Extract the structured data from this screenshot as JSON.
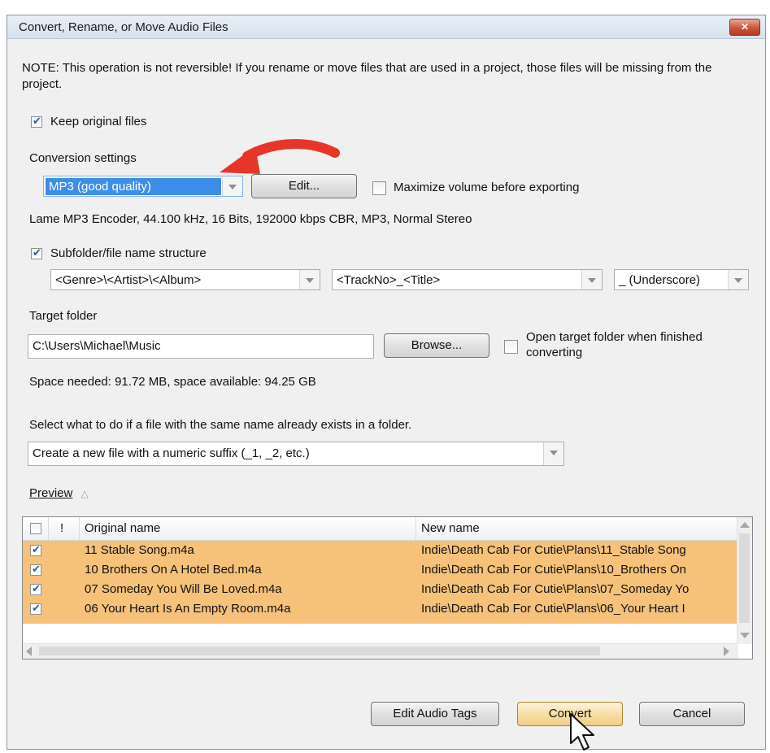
{
  "window": {
    "title": "Convert, Rename, or Move Audio Files",
    "close_glyph": "✕"
  },
  "note": "NOTE: This operation is not reversible! If you rename or move files that are used in a project, those files will be missing from the project.",
  "keep_original": {
    "label": "Keep original files",
    "checked": true
  },
  "conversion": {
    "heading": "Conversion settings",
    "selected": "MP3 (good quality)",
    "edit_label": "Edit...",
    "maximize_label": "Maximize volume before exporting",
    "maximize_checked": false,
    "encoder_info": "Lame MP3 Encoder, 44.100 kHz, 16 Bits, 192000 kbps CBR, MP3, Normal Stereo"
  },
  "subfolder": {
    "label": "Subfolder/file name structure",
    "checked": true,
    "folder_pattern": "<Genre>\\<Artist>\\<Album>",
    "file_pattern": "<TrackNo>_<Title>",
    "separator": "_ (Underscore)"
  },
  "target": {
    "heading": "Target folder",
    "path": "C:\\Users\\Michael\\Music",
    "browse_label": "Browse...",
    "open_when_finished_line1": "Open target folder when finished",
    "open_when_finished_line2": "converting",
    "open_checked": false
  },
  "space_info": "Space needed: 91.72 MB, space available: 94.25 GB",
  "existing": {
    "heading": "Select what to do if a file with the same name already exists in a folder.",
    "selected": "Create a new file with a numeric suffix (_1, _2, etc.)"
  },
  "preview": {
    "label": "Preview",
    "toggle_glyph": "△",
    "columns": {
      "flag": "!",
      "original": "Original name",
      "new": "New name"
    },
    "rows": [
      {
        "checked": true,
        "original": "11 Stable Song.m4a",
        "new": "Indie\\Death Cab For Cutie\\Plans\\11_Stable Song"
      },
      {
        "checked": true,
        "original": "10 Brothers On A Hotel Bed.m4a",
        "new": "Indie\\Death Cab For Cutie\\Plans\\10_Brothers On"
      },
      {
        "checked": true,
        "original": "07 Someday You Will Be Loved.m4a",
        "new": "Indie\\Death Cab For Cutie\\Plans\\07_Someday Yo"
      },
      {
        "checked": true,
        "original": "06 Your Heart Is An Empty Room.m4a",
        "new": "Indie\\Death Cab For Cutie\\Plans\\06_Your Heart I"
      }
    ]
  },
  "buttons": {
    "edit_tags": "Edit Audio Tags",
    "convert": "Convert",
    "cancel": "Cancel"
  },
  "colors": {
    "selection_blue": "#3d8ee8",
    "row_highlight": "#f6c27a",
    "annotation_arrow": "#e8352a"
  }
}
